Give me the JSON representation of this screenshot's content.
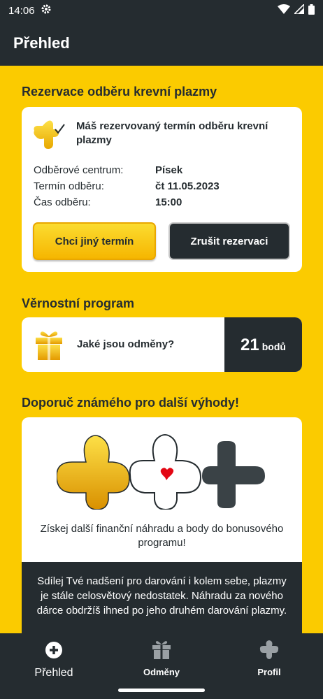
{
  "status_bar": {
    "time": "14:06"
  },
  "app_bar": {
    "title": "Přehled"
  },
  "reservation": {
    "section_title": "Rezervace odběru krevní plazmy",
    "header_text": "Máš rezervovaný termín odběru krevní plazmy",
    "rows": [
      {
        "label": "Odběrové centrum:",
        "value": "Písek"
      },
      {
        "label": "Termín odběru:",
        "value": "čt 11.05.2023"
      },
      {
        "label": "Čas odběru:",
        "value": "15:00"
      }
    ],
    "btn_other": "Chci jiný termín",
    "btn_cancel": "Zrušit rezervaci"
  },
  "loyalty": {
    "section_title": "Věrnostní program",
    "question": "Jaké jsou odměny?",
    "points": "21",
    "points_unit": "bodů"
  },
  "referral": {
    "section_title": "Doporuč známého pro další výhody!",
    "text": "Získej další finanční náhradu a body do bonusového programu!",
    "dark_text": "Sdílej Tvé nadšení pro darování i kolem sebe, plazmy je stále celosvětový nedostatek. Náhradu za nového dárce obdržíš ihned po jeho druhém darování plazmy."
  },
  "bottom_nav": [
    {
      "label": "Přehled",
      "icon": "plus-circle-icon"
    },
    {
      "label": "Odměny",
      "icon": "gift-icon"
    },
    {
      "label": "Profil",
      "icon": "profile-plus-icon"
    }
  ],
  "colors": {
    "brand_yellow": "#fbcb00",
    "dark": "#252c30"
  }
}
